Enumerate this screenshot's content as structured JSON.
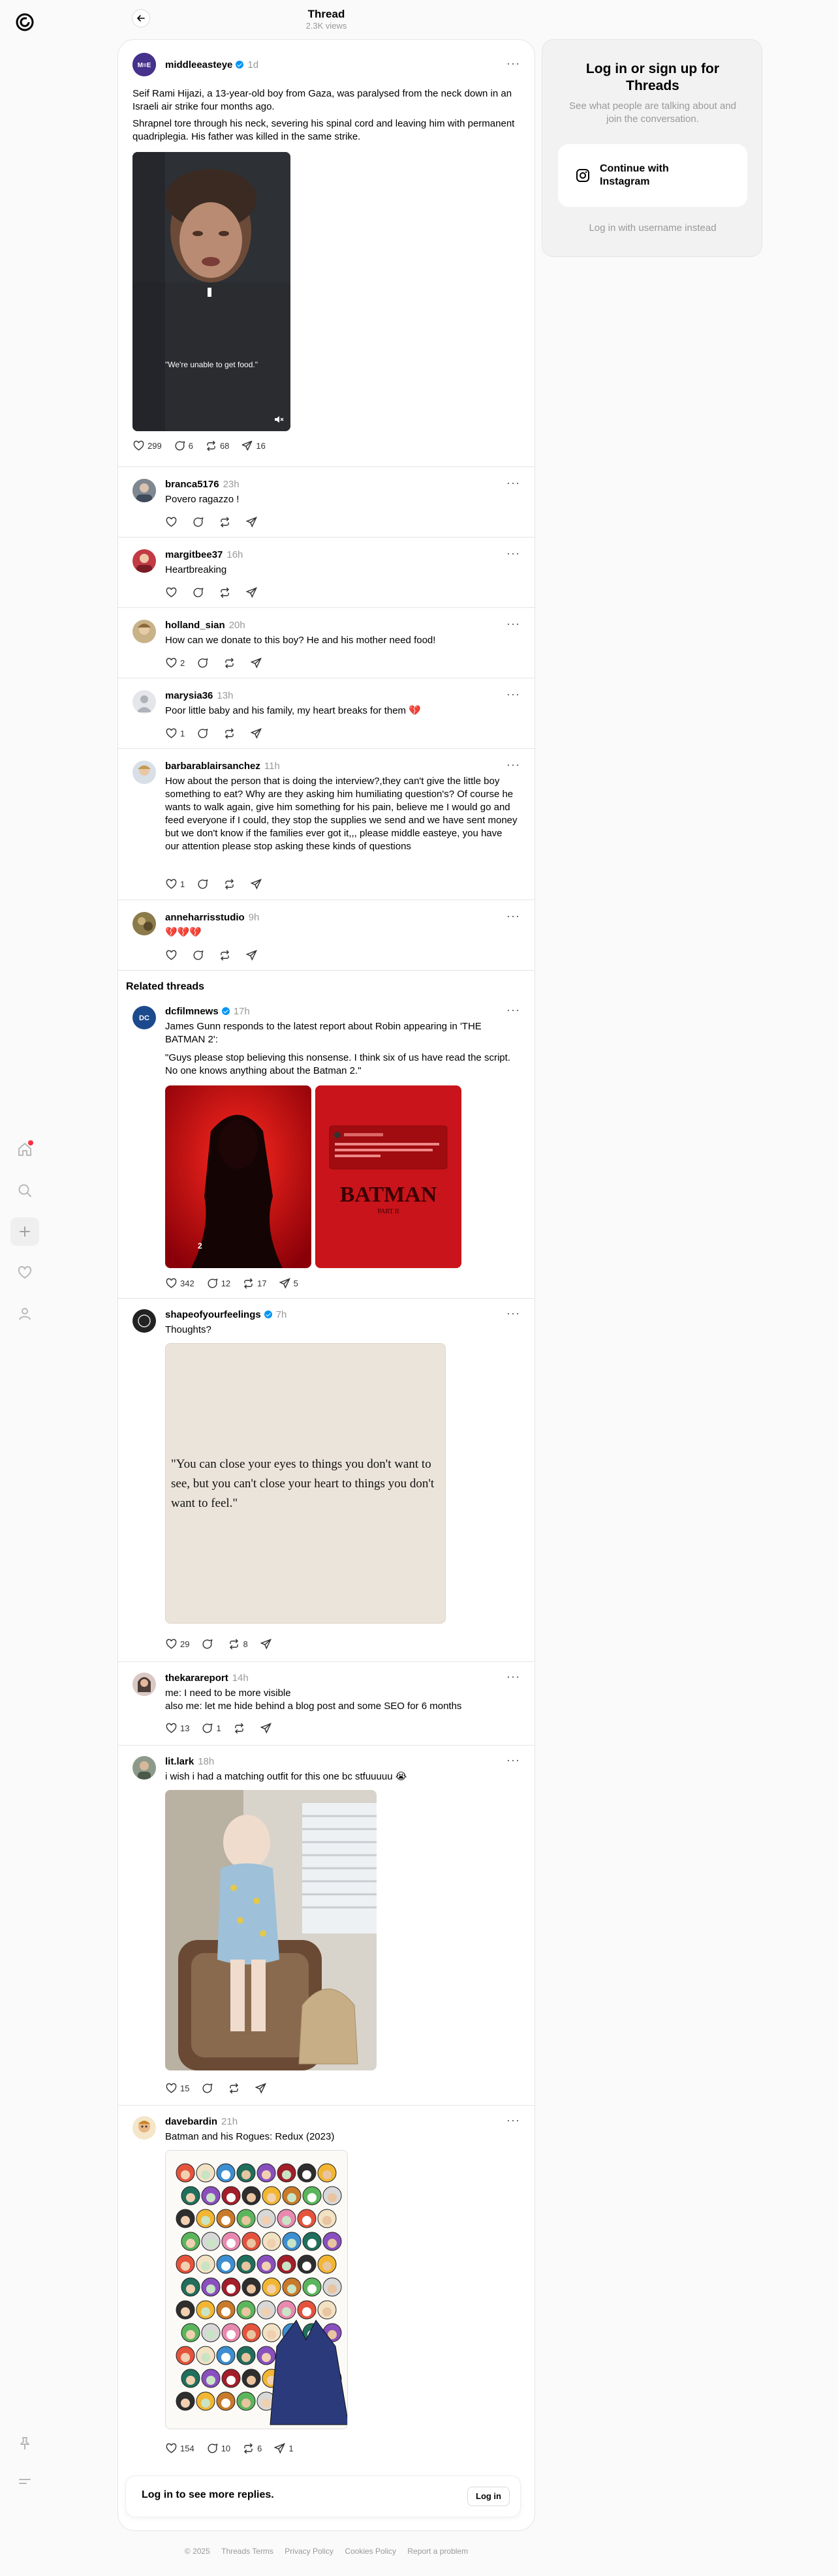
{
  "header": {
    "title": "Thread",
    "views": "2.3K views"
  },
  "main_post": {
    "username": "middleeasteye",
    "time": "1d",
    "text1": "Seif Rami Hijazi, a 13-year-old boy from Gaza, was paralysed from the neck down in an Israeli air strike four months ago.",
    "text2": "Shrapnel tore through his neck, severing his spinal cord and leaving him with permanent quadriplegia. His father was killed in the same strike.",
    "video_caption": "\"We're unable to get food.\"",
    "likes": "299",
    "replies": "6",
    "reposts": "68",
    "shares": "16"
  },
  "replies": [
    {
      "username": "branca5176",
      "time": "23h",
      "text": "Povero ragazzo !",
      "likes": "",
      "replies": "",
      "reposts": "",
      "shares": ""
    },
    {
      "username": "margitbee37",
      "time": "16h",
      "text": "Heartbreaking",
      "likes": "",
      "replies": "",
      "reposts": "",
      "shares": ""
    },
    {
      "username": "holland_sian",
      "time": "20h",
      "text": "How can we donate to this boy? He and his mother need food!",
      "likes": "2",
      "replies": "",
      "reposts": "",
      "shares": ""
    },
    {
      "username": "marysia36",
      "time": "13h",
      "text": "Poor little baby and his family, my heart breaks for them 💔",
      "likes": "1",
      "replies": "",
      "reposts": "",
      "shares": ""
    },
    {
      "username": "barbarablairsanchez",
      "time": "11h",
      "text": "How about the person that is doing the interview?,they can't give the little boy something to eat? Why are they asking him humiliating question's? Of course he wants to walk again, give him something for his pain, believe me I would go and feed everyone if I could, they stop the supplies we send and we have sent money but we don't know if the families ever got it,,, please middle easteye, you have our attention please stop asking these kinds of questions",
      "likes": "1",
      "replies": "",
      "reposts": "",
      "shares": ""
    },
    {
      "username": "anneharrisstudio",
      "time": "9h",
      "text": "💔💔💔",
      "likes": "",
      "replies": "",
      "reposts": "",
      "shares": ""
    }
  ],
  "related_title": "Related threads",
  "related": [
    {
      "username": "dcfilmnews",
      "time": "17h",
      "text1": "James Gunn responds to the latest report about Robin appearing in 'THE BATMAN 2':",
      "text2": "\"Guys please stop believing this nonsense. I think six of us have read the script. No one knows anything about the Batman 2.\"",
      "image_text": "THE BATMAN PART II",
      "likes": "342",
      "replies": "12",
      "reposts": "17",
      "shares": "5"
    },
    {
      "username": "shapeofyourfeelings",
      "time": "7h",
      "text": "Thoughts?",
      "quote": "\"You can close your eyes to things you don't want to see, but you can't close your heart to things you don't want to feel.\"",
      "likes": "29",
      "replies": "",
      "reposts": "8",
      "shares": ""
    },
    {
      "username": "thekarareport",
      "time": "14h",
      "text1": "me: I need to be more visible",
      "text2": "also me: let me hide behind a blog post and some SEO for 6 months",
      "likes": "13",
      "replies": "1",
      "reposts": "",
      "shares": ""
    },
    {
      "username": "lit.lark",
      "time": "18h",
      "text": "i wish i had a matching outfit for this one bc stfuuuuu 😭",
      "likes": "15",
      "replies": "",
      "reposts": "",
      "shares": ""
    },
    {
      "username": "davebardin",
      "time": "21h",
      "text": "Batman and his Rogues: Redux (2023)",
      "likes": "154",
      "replies": "10",
      "reposts": "6",
      "shares": "1"
    }
  ],
  "login_bar": {
    "text": "Log in to see more replies.",
    "button": "Log in"
  },
  "side": {
    "title": "Log in or sign up for Threads",
    "subtitle": "See what people are talking about and join the conversation.",
    "button": "Continue with Instagram",
    "link": "Log in with username instead"
  },
  "footer": [
    "© 2025",
    "Threads Terms",
    "Privacy Policy",
    "Cookies Policy",
    "Report a problem"
  ],
  "colors": {
    "verified": "#0095f6",
    "accent_red": "#c8141a",
    "notification": "#ff3040"
  }
}
